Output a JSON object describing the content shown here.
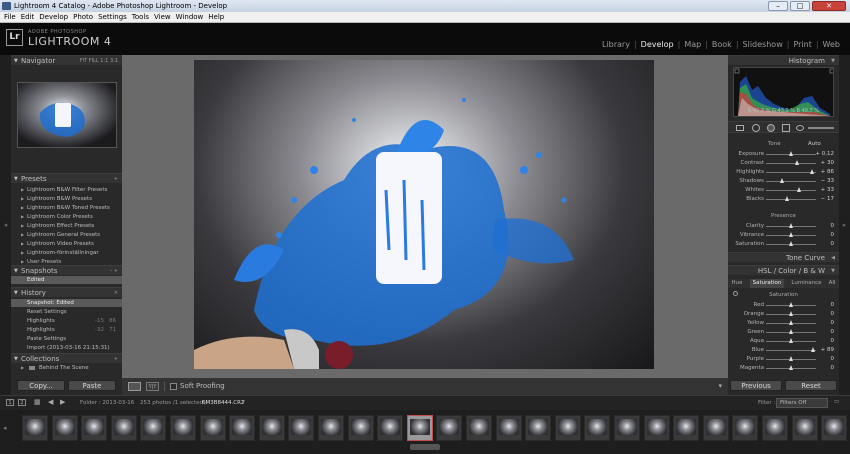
{
  "window": {
    "title": "Lightroom 4 Catalog - Adobe Photoshop Lightroom - Develop",
    "min": "–",
    "max": "□",
    "close": "✕"
  },
  "menu": [
    "File",
    "Edit",
    "Develop",
    "Photo",
    "Settings",
    "Tools",
    "View",
    "Window",
    "Help"
  ],
  "brand": {
    "logo": "Lr",
    "sub": "ADOBE PHOTOSHOP",
    "name": "LIGHTROOM 4"
  },
  "modules": [
    {
      "label": "Library",
      "active": false
    },
    {
      "label": "Develop",
      "active": true
    },
    {
      "label": "Map",
      "active": false
    },
    {
      "label": "Book",
      "active": false
    },
    {
      "label": "Slideshow",
      "active": false
    },
    {
      "label": "Print",
      "active": false
    },
    {
      "label": "Web",
      "active": false
    }
  ],
  "navigator": {
    "title": "Navigator",
    "zoom": "FIT  FILL  1:1  3:1"
  },
  "presets": {
    "title": "Presets",
    "add": "+",
    "items": [
      "Lightroom B&W Filter Presets",
      "Lightroom B&W Presets",
      "Lightroom B&W Toned Presets",
      "Lightroom Color Presets",
      "Lightroom Effect Presets",
      "Lightroom General Presets",
      "Lightroom Video Presets",
      "Lightroom-förinställningar",
      "User Presets"
    ]
  },
  "snapshots": {
    "title": "Snapshots",
    "controls": "–  +",
    "items": [
      "Edited"
    ]
  },
  "history": {
    "title": "History",
    "close": "×",
    "items": [
      {
        "label": "Snapshot: Edited",
        "v1": "",
        "v2": "",
        "selected": true
      },
      {
        "label": "Reset Settings",
        "v1": "",
        "v2": "",
        "selected": false
      },
      {
        "label": "Highlights",
        "v1": "-15",
        "v2": "86",
        "selected": false
      },
      {
        "label": "Highlights",
        "v1": "-32",
        "v2": "71",
        "selected": false
      },
      {
        "label": "Paste Settings",
        "v1": "",
        "v2": "",
        "selected": false
      },
      {
        "label": "Import (2013-03-16 21:15:31)",
        "v1": "",
        "v2": "",
        "selected": false
      }
    ]
  },
  "collections": {
    "title": "Collections",
    "add": "+",
    "items": [
      "Behind The Scene"
    ]
  },
  "left_buttons": {
    "copy": "Copy...",
    "paste": "Paste"
  },
  "toolbar": {
    "soft_proofing": "Soft Proofing"
  },
  "histogram": {
    "title": "Histogram",
    "readout": "R  40,7  %   G  43,0  %   B  48,7  %"
  },
  "basic": {
    "tone": "Tone",
    "auto": "Auto",
    "presence": "Presence",
    "sliders": [
      {
        "label": "Exposure",
        "value": "+ 0,12",
        "pos": 0.51
      },
      {
        "label": "Contrast",
        "value": "+ 30",
        "pos": 0.62
      },
      {
        "label": "Highlights",
        "value": "+ 86",
        "pos": 0.93
      },
      {
        "label": "Shadows",
        "value": "− 33",
        "pos": 0.33
      },
      {
        "label": "Whites",
        "value": "+ 33",
        "pos": 0.66
      },
      {
        "label": "Blacks",
        "value": "− 17",
        "pos": 0.42
      },
      {
        "label": "Clarity",
        "value": "0",
        "pos": 0.5
      },
      {
        "label": "Vibrance",
        "value": "0",
        "pos": 0.5
      },
      {
        "label": "Saturation",
        "value": "0",
        "pos": 0.5
      }
    ]
  },
  "tonecurve": {
    "title": "Tone Curve"
  },
  "hsl": {
    "title": "HSL  /  Color  /  B & W",
    "tabs": [
      "Hue",
      "Saturation",
      "Luminance",
      "All"
    ],
    "group": "Saturation",
    "sliders": [
      {
        "label": "Red",
        "value": "0",
        "pos": 0.5
      },
      {
        "label": "Orange",
        "value": "0",
        "pos": 0.5
      },
      {
        "label": "Yellow",
        "value": "0",
        "pos": 0.5
      },
      {
        "label": "Green",
        "value": "0",
        "pos": 0.5
      },
      {
        "label": "Aqua",
        "value": "0",
        "pos": 0.5
      },
      {
        "label": "Blue",
        "value": "+ 89",
        "pos": 0.94
      },
      {
        "label": "Purple",
        "value": "0",
        "pos": 0.5
      },
      {
        "label": "Magenta",
        "value": "0",
        "pos": 0.5
      }
    ]
  },
  "right_buttons": {
    "previous": "Previous",
    "reset": "Reset"
  },
  "filmbar": {
    "page1": "1",
    "page2": "2",
    "folder": "Folder : 2013-03-16",
    "count": "253 photos /1 selected /",
    "file": "6M3B8444.CR2",
    "filter_label": "Filter :",
    "filter_value": "Filters Off"
  },
  "colors": {
    "accent": "#c0504d",
    "panel": "#292929",
    "blue": "#1f6fd1"
  }
}
